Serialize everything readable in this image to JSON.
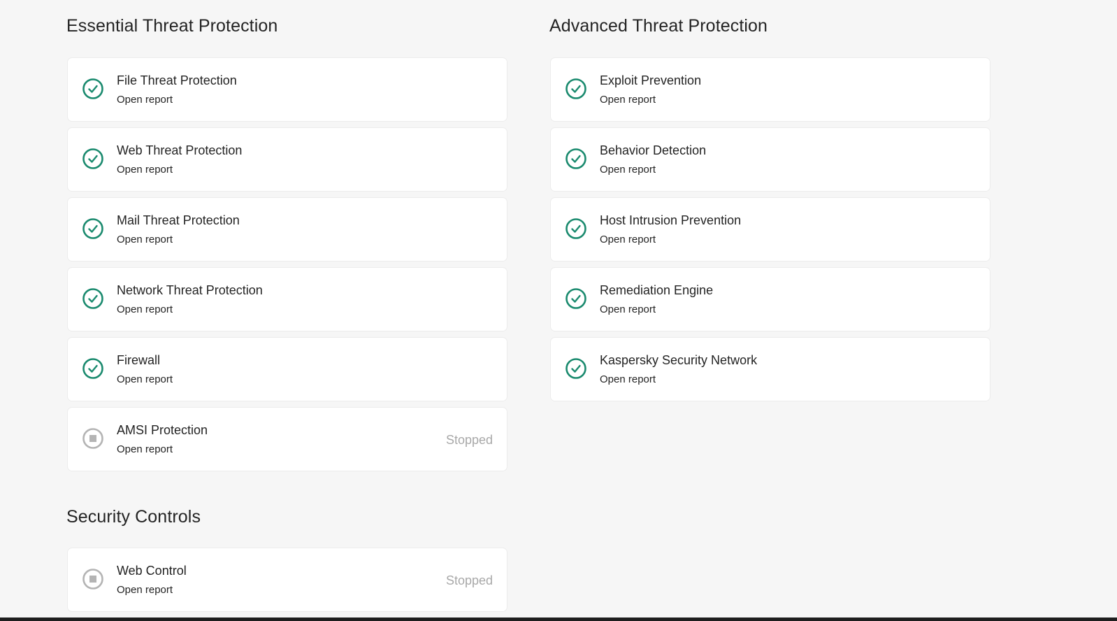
{
  "colors": {
    "enabled_green": "#1a8a6e",
    "stopped_gray": "#b4b4b4",
    "background": "#f6f6f6",
    "card": "#ffffff"
  },
  "essential": {
    "title": "Essential Threat Protection",
    "items": [
      {
        "name": "File Threat Protection",
        "link": "Open report",
        "state": "",
        "icon": "check-circle-icon"
      },
      {
        "name": "Web Threat Protection",
        "link": "Open report",
        "state": "",
        "icon": "check-circle-icon"
      },
      {
        "name": "Mail Threat Protection",
        "link": "Open report",
        "state": "",
        "icon": "check-circle-icon"
      },
      {
        "name": "Network Threat Protection",
        "link": "Open report",
        "state": "",
        "icon": "check-circle-icon"
      },
      {
        "name": "Firewall",
        "link": "Open report",
        "state": "",
        "icon": "check-circle-icon"
      },
      {
        "name": "AMSI Protection",
        "link": "Open report",
        "state": "Stopped",
        "icon": "stopped-circle-icon"
      }
    ]
  },
  "advanced": {
    "title": "Advanced Threat Protection",
    "items": [
      {
        "name": "Exploit Prevention",
        "link": "Open report",
        "state": "",
        "icon": "check-circle-icon"
      },
      {
        "name": "Behavior Detection",
        "link": "Open report",
        "state": "",
        "icon": "check-circle-icon"
      },
      {
        "name": "Host Intrusion Prevention",
        "link": "Open report",
        "state": "",
        "icon": "check-circle-icon"
      },
      {
        "name": "Remediation Engine",
        "link": "Open report",
        "state": "",
        "icon": "check-circle-icon"
      },
      {
        "name": "Kaspersky Security Network",
        "link": "Open report",
        "state": "",
        "icon": "check-circle-icon"
      }
    ]
  },
  "controls": {
    "title": "Security Controls",
    "items": [
      {
        "name": "Web Control",
        "link": "Open report",
        "state": "Stopped",
        "icon": "stopped-circle-icon"
      }
    ]
  }
}
